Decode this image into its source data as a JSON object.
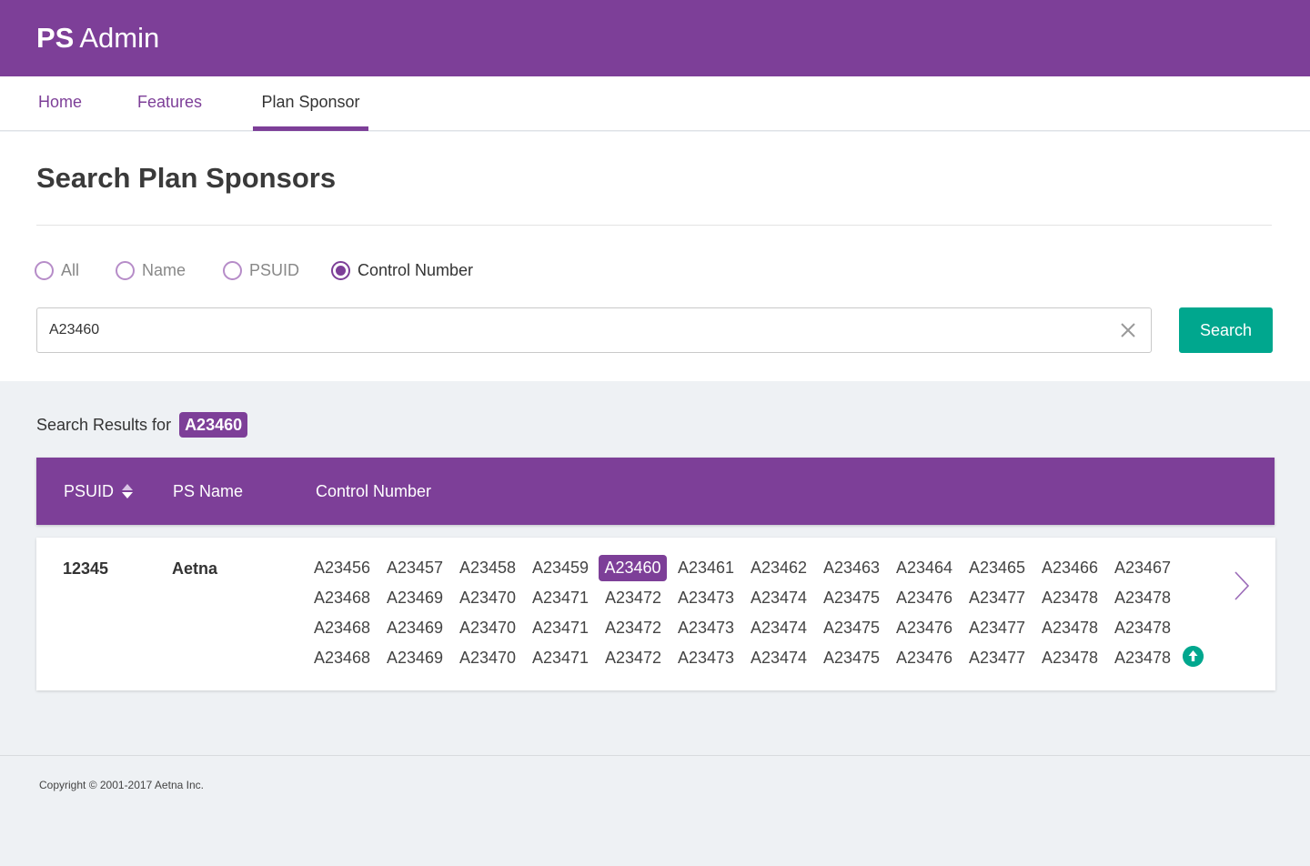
{
  "app": {
    "brand_bold": "PS",
    "brand_light": "Admin"
  },
  "nav": {
    "tabs": [
      {
        "label": "Home"
      },
      {
        "label": "Features"
      },
      {
        "label": "Plan Sponsor"
      }
    ],
    "active": "Plan Sponsor"
  },
  "search": {
    "title": "Search Plan Sponsors",
    "filters": [
      {
        "label": "All"
      },
      {
        "label": "Name"
      },
      {
        "label": "PSUID"
      },
      {
        "label": "Control Number"
      }
    ],
    "selected_filter": "Control Number",
    "query": "A23460",
    "button_label": "Search"
  },
  "results": {
    "label": "Search Results for",
    "term": "A23460",
    "columns": [
      {
        "label": "PSUID"
      },
      {
        "label": "PS Name"
      },
      {
        "label": "Control Number"
      }
    ],
    "rows": [
      {
        "psuid": "12345",
        "ps_name": "Aetna",
        "control_numbers": [
          [
            "A23456",
            "A23457",
            "A23458",
            "A23459",
            "A23460",
            "A23461",
            "A23462",
            "A23463",
            "A23464",
            "A23465",
            "A23466",
            "A23467"
          ],
          [
            "A23468",
            "A23469",
            "A23470",
            "A23471",
            "A23472",
            "A23473",
            "A23474",
            "A23475",
            "A23476",
            "A23477",
            "A23478",
            "A23478"
          ],
          [
            "A23468",
            "A23469",
            "A23470",
            "A23471",
            "A23472",
            "A23473",
            "A23474",
            "A23475",
            "A23476",
            "A23477",
            "A23478",
            "A23478"
          ],
          [
            "A23468",
            "A23469",
            "A23470",
            "A23471",
            "A23472",
            "A23473",
            "A23474",
            "A23475",
            "A23476",
            "A23477",
            "A23478",
            "A23478"
          ]
        ],
        "highlighted": "A23460"
      }
    ]
  },
  "footer": {
    "copyright": "Copyright © 2001-2017 Aetna Inc."
  },
  "colors": {
    "primary": "#7d3f98",
    "accent": "#00a78e",
    "background": "#eef1f4"
  },
  "icons": {
    "clear": "close-icon",
    "sort": "sort-icon",
    "expand": "chevron-right-icon",
    "collapse": "arrow-up-icon"
  }
}
